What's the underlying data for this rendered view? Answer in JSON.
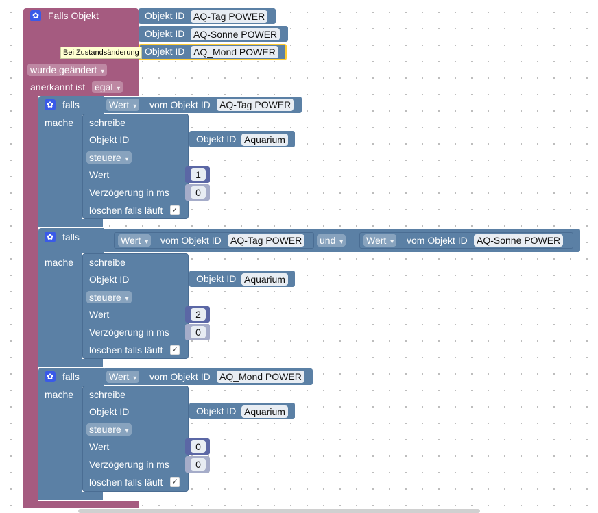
{
  "trigger": {
    "title": "Falls Objekt",
    "objects": [
      {
        "label": "Objekt ID",
        "value": "AQ-Tag POWER"
      },
      {
        "label": "Objekt ID",
        "value": "AQ-Sonne POWER"
      },
      {
        "label": "Objekt ID",
        "value": "AQ_Mond POWER"
      }
    ],
    "tooltip": "Bei Zustandsänderung",
    "changed_option": "wurde geändert",
    "ack_label": "anerkannt ist",
    "ack_option": "egal"
  },
  "blocks": [
    {
      "falls_label": "falls",
      "mache_label": "mache",
      "conditions": [
        {
          "prop": "Wert",
          "of_label": "vom Objekt ID",
          "object": "AQ-Tag POWER"
        }
      ],
      "action": {
        "title": "schreibe",
        "oid_label": "Objekt ID",
        "inner_oid_label": "Objekt ID",
        "inner_oid_value": "Aquarium",
        "mode": "steuere",
        "value_label": "Wert",
        "value": "1",
        "delay_label": "Verzögerung in ms",
        "delay": "0",
        "clear_label": "löschen falls läuft"
      }
    },
    {
      "falls_label": "falls",
      "mache_label": "mache",
      "conditions": [
        {
          "prop": "Wert",
          "of_label": "vom Objekt ID",
          "object": "AQ-Tag POWER"
        },
        {
          "prop": "Wert",
          "of_label": "vom Objekt ID",
          "object": "AQ-Sonne POWER"
        }
      ],
      "logic_op": "und",
      "action": {
        "title": "schreibe",
        "oid_label": "Objekt ID",
        "inner_oid_label": "Objekt ID",
        "inner_oid_value": "Aquarium",
        "mode": "steuere",
        "value_label": "Wert",
        "value": "2",
        "delay_label": "Verzögerung in ms",
        "delay": "0",
        "clear_label": "löschen falls läuft"
      }
    },
    {
      "falls_label": "falls",
      "mache_label": "mache",
      "conditions": [
        {
          "prop": "Wert",
          "of_label": "vom Objekt ID",
          "object": "AQ_Mond POWER"
        }
      ],
      "action": {
        "title": "schreibe",
        "oid_label": "Objekt ID",
        "inner_oid_label": "Objekt ID",
        "inner_oid_value": "Aquarium",
        "mode": "steuere",
        "value_label": "Wert",
        "value": "0",
        "delay_label": "Verzögerung in ms",
        "delay": "0",
        "clear_label": "löschen falls läuft"
      }
    }
  ],
  "colors": {
    "trigger": "#a55b80",
    "logic": "#5b80a5",
    "number": "#5b67a5",
    "highlight": "#fc3"
  },
  "icons": {
    "gear": "gear-icon",
    "check": "checkmark-icon",
    "dropdown": "dropdown-arrow-icon"
  }
}
